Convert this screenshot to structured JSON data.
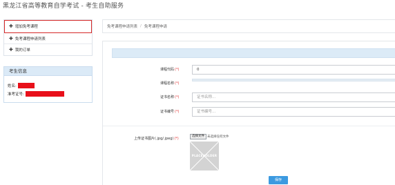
{
  "header": {
    "title": "黑龙江省高等教育自学考试 - 考生自助服务"
  },
  "menu": {
    "items": [
      {
        "label": "增加免考课程"
      },
      {
        "label": "免考课程申请列表"
      },
      {
        "label": "我的订单"
      }
    ]
  },
  "student_info": {
    "title": "考生信息",
    "name_label": "姓名:",
    "exam_id_label": "准考证号:"
  },
  "breadcrumb": {
    "items": [
      "免考课程申请列表",
      "免考课程申请"
    ],
    "separator": "/"
  },
  "form": {
    "course_code": {
      "label": "课程代码",
      "required_mark": "(*)",
      "value": "0"
    },
    "course_name": {
      "label": "课程名称",
      "required_mark": "(*)"
    },
    "cert_name": {
      "label": "证书名称",
      "required_mark": "(*)",
      "placeholder": "证书名称..."
    },
    "cert_number": {
      "label": "证书编号",
      "required_mark": "(*)",
      "placeholder": "证书编号..."
    },
    "upload": {
      "label": "上传证书图片(.jpg/.jpeg)",
      "required_mark": "(*)",
      "choose_button": "选择文件",
      "status": "未选择任何文件",
      "preview_text": "PLACEHOLDER"
    },
    "save_button": "保存"
  },
  "colors": {
    "accent": "#3c9ae0",
    "highlight_border": "#d62828",
    "redaction": "#e8101a",
    "required": "#e03030",
    "panel_header": "#dbeaf7"
  }
}
